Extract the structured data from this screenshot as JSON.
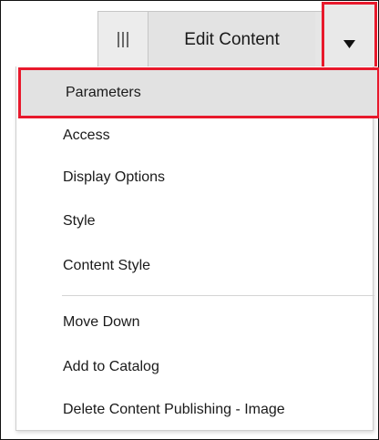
{
  "toolbar": {
    "drag_handle_icon": "vertical-bars-icon",
    "edit_label": "Edit Content",
    "dropdown_icon": "caret-down-icon"
  },
  "menu": {
    "items": [
      {
        "label": "Parameters",
        "highlighted": true
      },
      {
        "label": "Access"
      },
      {
        "label": "Display Options"
      },
      {
        "label": "Style"
      },
      {
        "label": "Content Style"
      },
      {
        "label": "Move Down"
      },
      {
        "label": "Add to Catalog"
      },
      {
        "label": "Delete Content Publishing - Image"
      }
    ]
  },
  "colors": {
    "highlight_border": "#e8192c",
    "highlight_bg": "#e2e2e2",
    "toolbar_bg": "#e6e6e6",
    "text": "#1a1a1a"
  }
}
